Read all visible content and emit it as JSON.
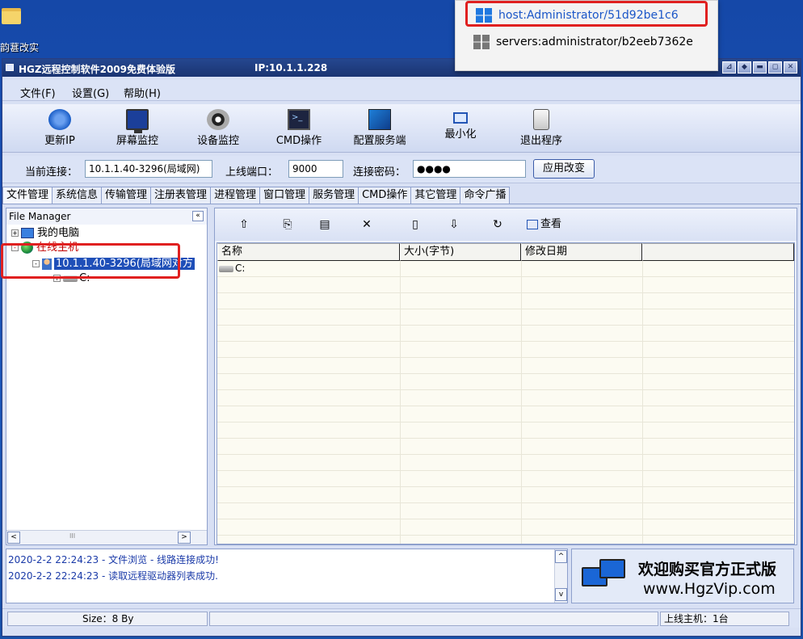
{
  "desktop": {
    "icon_label": "韵葚改实"
  },
  "window": {
    "title": "HGZ远程控制软件2009免费体验版",
    "ip": "IP:10.1.1.228",
    "buttons": [
      "⊿",
      "◆",
      "▬",
      "◻",
      "✕"
    ]
  },
  "menu": [
    "文件(F)",
    "设置(G)",
    "帮助(H)"
  ],
  "toolbar": [
    {
      "label": "更新IP",
      "icon": "refresh-ip-icon"
    },
    {
      "label": "屏幕监控",
      "icon": "monitor-icon"
    },
    {
      "label": "设备监控",
      "icon": "camera-icon"
    },
    {
      "label": "CMD操作",
      "icon": "cmd-icon"
    },
    {
      "label": "配置服务端",
      "icon": "config-server-icon"
    },
    {
      "label": "最小化",
      "icon": "minimize-icon"
    },
    {
      "label": "退出程序",
      "icon": "exit-icon"
    }
  ],
  "connection": {
    "current_label": "当前连接：",
    "current_value": "10.1.1.40-3296(局域网)",
    "port_label": "上线端口：",
    "port_value": "9000",
    "password_label": "连接密码：",
    "password_value": "●●●●",
    "apply_label": "应用改变"
  },
  "tabs": [
    "文件管理",
    "系统信息",
    "传输管理",
    "注册表管理",
    "进程管理",
    "窗口管理",
    "服务管理",
    "CMD操作",
    "其它管理",
    "命令广播"
  ],
  "left_pane": {
    "header": "File Manager",
    "collapse": "«",
    "tree": {
      "my_computer": "我的电脑",
      "online_hosts": "在线主机",
      "host": "10.1.1.40-3296(局域网对方",
      "drive": "C:"
    },
    "scroll_left": "<",
    "scroll_mid": "III",
    "scroll_right": ">"
  },
  "right_pane": {
    "tools": [
      "up-folder-icon",
      "copy-icon",
      "paste-icon",
      "delete-icon",
      "new-file-icon",
      "download-icon",
      "refresh-icon"
    ],
    "view_label": "查看",
    "columns": [
      "名称",
      "大小(字节)",
      "修改日期",
      ""
    ],
    "rows": [
      {
        "name": "C:",
        "size": "",
        "date": ""
      }
    ]
  },
  "log": {
    "lines": [
      "2020-2-2 22:24:23 - 文件浏览 - 线路连接成功!",
      "2020-2-2 22:24:23 - 读取远程驱动器列表成功."
    ],
    "scroll_up": "^",
    "scroll_down": "v"
  },
  "ad": {
    "line1": "欢迎购买官方正式版",
    "line2": "www.HgzVip.com"
  },
  "status": {
    "size": "Size：8 By",
    "online": "上线主机：1台"
  },
  "popup": {
    "items": [
      {
        "label": "host:Administrator/51d92be1c6",
        "active": true
      },
      {
        "label": "servers:administrator/b2eeb7362e",
        "active": false
      }
    ]
  },
  "colors": {
    "titlebar": "#1a3472",
    "selection": "#1f4fb8",
    "highlight_box": "#e02020",
    "log_text": "#1a3aa8"
  }
}
